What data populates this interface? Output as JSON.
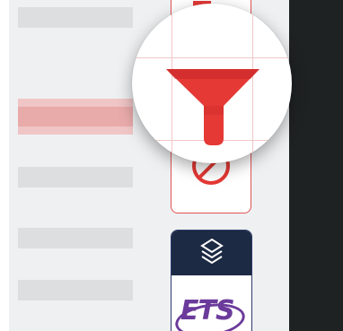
{
  "colors": {
    "accent_red": "#e53935",
    "panel_bg": "#eef0f2",
    "placeholder_bar": "#dcdee0",
    "highlight_bar": "#e9aaaa",
    "dark_pane": "#1f2223",
    "layers_header": "#1c2a43",
    "ets_purple": "#6b3b9b"
  },
  "toolbar": {
    "tools": [
      {
        "name": "sort",
        "icon": "sort-arrow-icon"
      },
      {
        "name": "filter",
        "icon": "funnel-filter-icon",
        "magnified": true
      },
      {
        "name": "clear-filter",
        "icon": "no-entry-icon"
      }
    ]
  },
  "layers_card": {
    "icon": "layers-icon",
    "logo_text": "ETS"
  },
  "list_rows": [
    {
      "state": "placeholder"
    },
    {
      "state": "placeholder"
    },
    {
      "state": "highlighted"
    },
    {
      "state": "placeholder"
    },
    {
      "state": "placeholder"
    },
    {
      "state": "placeholder"
    }
  ]
}
